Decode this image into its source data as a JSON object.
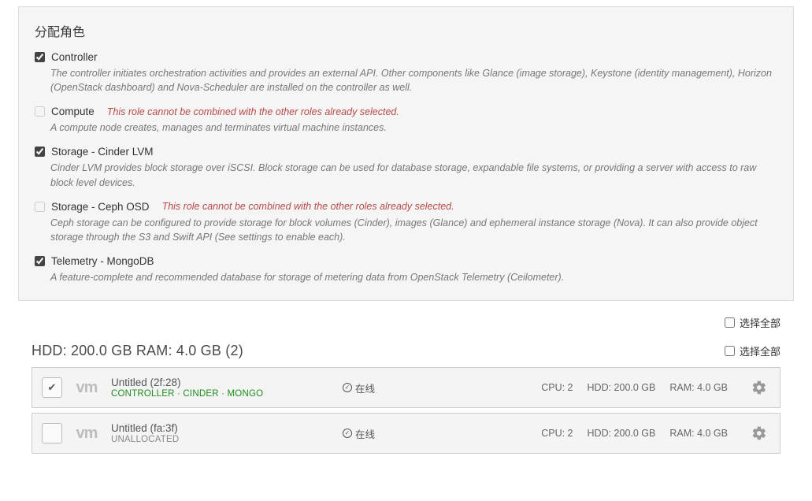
{
  "roles_panel": {
    "title": "分配角色",
    "items": [
      {
        "id": "controller",
        "label": "Controller",
        "checked": true,
        "disabled": false,
        "restriction": "",
        "description": "The controller initiates orchestration activities and provides an external API. Other components like Glance (image storage), Keystone (identity management), Horizon (OpenStack dashboard) and Nova-Scheduler are installed on the controller as well."
      },
      {
        "id": "compute",
        "label": "Compute",
        "checked": false,
        "disabled": true,
        "restriction": "This role cannot be combined with the other roles already selected.",
        "description": "A compute node creates, manages and terminates virtual machine instances."
      },
      {
        "id": "storage-cinder-lvm",
        "label": "Storage - Cinder LVM",
        "checked": true,
        "disabled": false,
        "restriction": "",
        "description": "Cinder LVM provides block storage over iSCSI. Block storage can be used for database storage, expandable file systems, or providing a server with access to raw block level devices."
      },
      {
        "id": "storage-ceph-osd",
        "label": "Storage - Ceph OSD",
        "checked": false,
        "disabled": true,
        "restriction": "This role cannot be combined with the other roles already selected.",
        "description": "Ceph storage can be configured to provide storage for block volumes (Cinder), images (Glance) and ephemeral instance storage (Nova). It can also provide object storage through the S3 and Swift API (See settings to enable each)."
      },
      {
        "id": "telemetry-mongodb",
        "label": "Telemetry - MongoDB",
        "checked": true,
        "disabled": false,
        "restriction": "",
        "description": "A feature-complete and recommended database for storage of metering data from OpenStack Telemetry (Ceilometer)."
      }
    ]
  },
  "select_all_label": "选择全部",
  "node_group": {
    "title": "HDD: 200.0 GB   RAM: 4.0 GB (2)",
    "select_all_label": "选择全部",
    "nodes": [
      {
        "checked": true,
        "name": "Untitled (2f:28)",
        "roles_text": "CONTROLLER · CINDER · MONGO",
        "roles_style": "green",
        "status_text": "在线",
        "cpu": "CPU: 2",
        "hdd": "HDD: 200.0 GB",
        "ram": "RAM: 4.0 GB"
      },
      {
        "checked": false,
        "name": "Untitled (fa:3f)",
        "roles_text": "UNALLOCATED",
        "roles_style": "gray",
        "status_text": "在线",
        "cpu": "CPU: 2",
        "hdd": "HDD: 200.0 GB",
        "ram": "RAM: 4.0 GB"
      }
    ]
  },
  "icons": {
    "vm_label": "vm"
  }
}
